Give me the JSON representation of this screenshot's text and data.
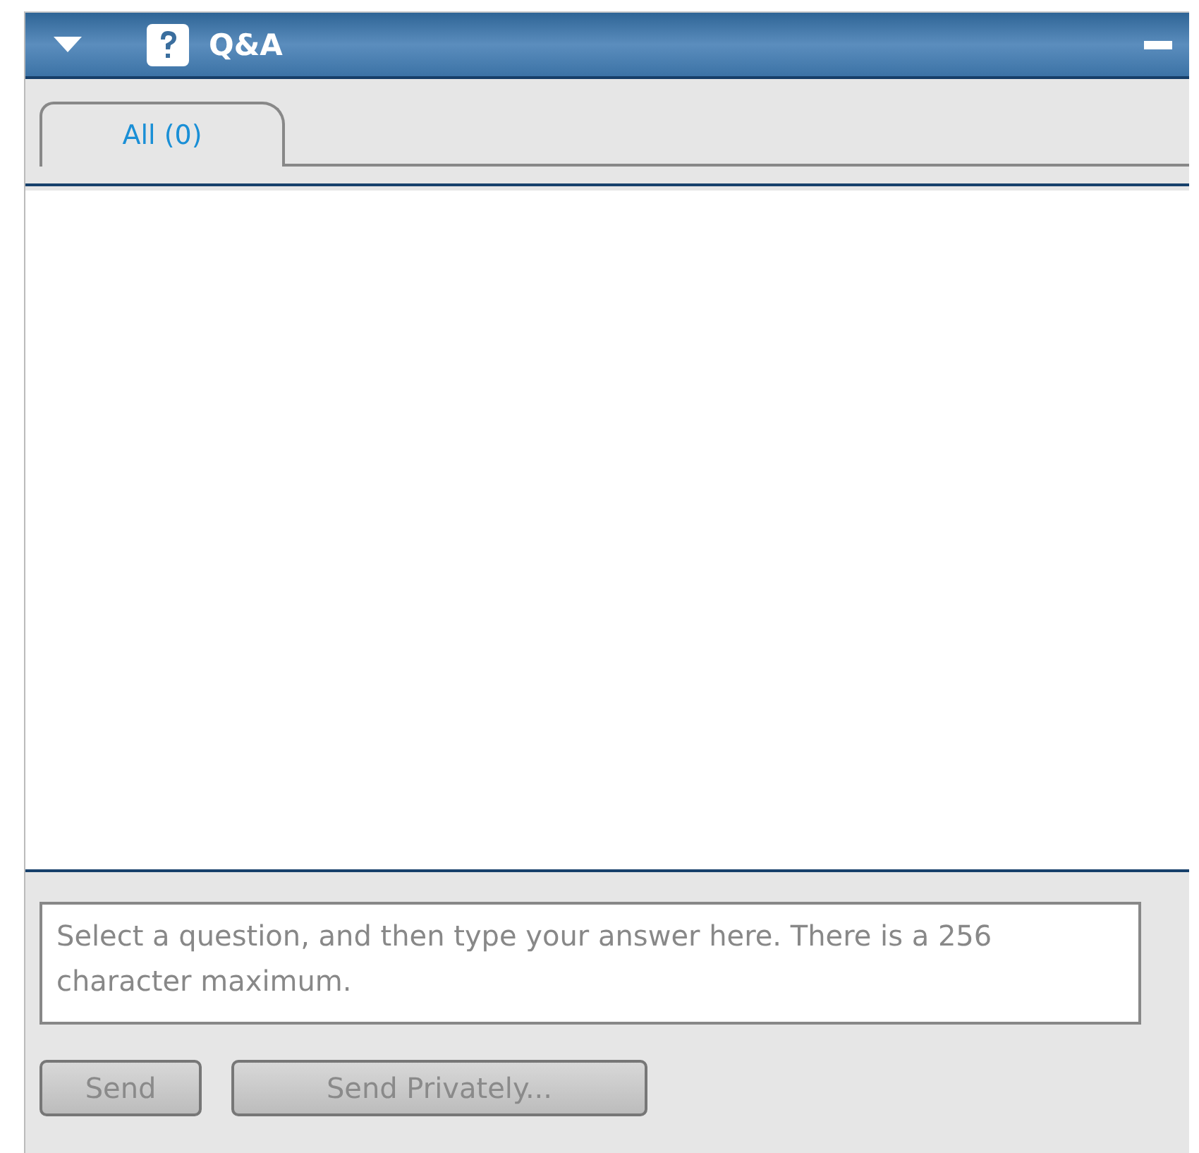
{
  "panel": {
    "title": "Q&A",
    "expanded": true
  },
  "tabs": [
    {
      "label": "All (0)",
      "selected": true
    }
  ],
  "answer": {
    "placeholder": "Select a question, and then type your answer here. There is a 256 character maximum."
  },
  "buttons": [
    {
      "label": "Send",
      "disabled": true
    },
    {
      "label": "Send Privately...",
      "disabled": true
    }
  ]
}
